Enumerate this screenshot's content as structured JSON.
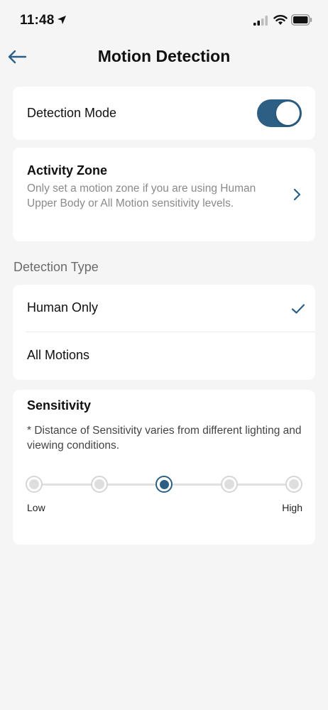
{
  "status_bar": {
    "time": "11:48"
  },
  "header": {
    "title": "Motion Detection"
  },
  "detection_mode": {
    "label": "Detection Mode",
    "enabled": true
  },
  "activity_zone": {
    "title": "Activity Zone",
    "description": "Only set a motion zone if you are using Human Upper Body or All Motion sensitivity levels."
  },
  "detection_type": {
    "section_label": "Detection Type",
    "options": [
      {
        "label": "Human Only",
        "selected": true
      },
      {
        "label": "All Motions",
        "selected": false
      }
    ]
  },
  "sensitivity": {
    "title": "Sensitivity",
    "note": "* Distance of Sensitivity varies from different lighting and viewing conditions.",
    "levels": 5,
    "selected_level": 3,
    "low_label": "Low",
    "high_label": "High"
  },
  "colors": {
    "accent": "#2d5f85",
    "background": "#f5f5f5",
    "card": "#ffffff",
    "muted_text": "#8a8a8a"
  }
}
